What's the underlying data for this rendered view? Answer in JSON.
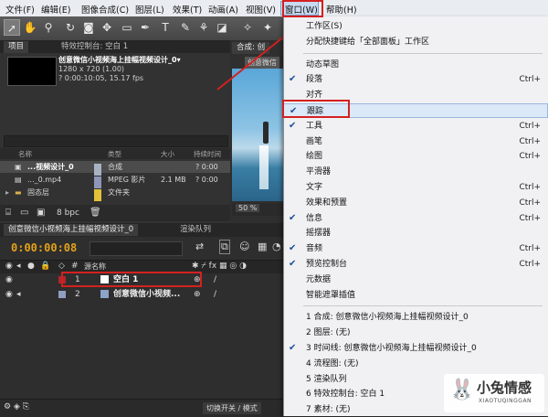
{
  "menubar": {
    "items": [
      "文件(F)",
      "编辑(E)",
      "图像合成(C)",
      "图层(L)",
      "效果(T)",
      "动画(A)",
      "视图(V)",
      "窗口(W)",
      "帮助(H)"
    ]
  },
  "project_panel": {
    "tabs": [
      "项目",
      "特效控制台: 空白 1"
    ],
    "comp_name": "创意微信小视频海上挂幅视频设计_0▾",
    "comp_res": "1280 x 720 (1.00)",
    "comp_duration": "? 0:00:10:05, 15.17 fps",
    "col_name": "名称",
    "col_type": "类型",
    "col_size": "大小",
    "col_duration": "持续时间",
    "rows": [
      {
        "name": "...视频设计_0",
        "type": "合成",
        "size": "",
        "dur": "? 0:00"
      },
      {
        "name": "..._0.mp4",
        "type": "MPEG 影片",
        "size": "2.1 MB",
        "dur": "? 0:00"
      },
      {
        "name": "固态层",
        "type": "文件夹",
        "size": "",
        "dur": ""
      }
    ],
    "bpc": "8 bpc"
  },
  "comp_viewer": {
    "tab": "合成: 创",
    "sub": "创意微信",
    "zoom": "50 %"
  },
  "timeline": {
    "tabs": [
      "创意微信小视频海上挂幅视频设计_0",
      "渲染队列"
    ],
    "timecode": "0:00:00:08",
    "col_source": "源名称",
    "layers": [
      {
        "num": "1",
        "name": "空白 1"
      },
      {
        "num": "2",
        "name": "创意微信小视频..."
      }
    ],
    "toggle_switch": "切换开关 / 模式"
  },
  "window_menu": {
    "items": [
      {
        "label": "工作区(S)",
        "shortcut": "",
        "checked": false
      },
      {
        "label": "分配快捷键给「全部面板」工作区",
        "shortcut": "",
        "checked": false
      },
      {
        "sep": true
      },
      {
        "label": "动态草图",
        "shortcut": "",
        "checked": false
      },
      {
        "label": "段落",
        "shortcut": "Ctrl+",
        "checked": true
      },
      {
        "label": "对齐",
        "shortcut": "",
        "checked": false
      },
      {
        "label": "跟踪",
        "shortcut": "",
        "checked": true,
        "highlight": true
      },
      {
        "label": "工具",
        "shortcut": "Ctrl+",
        "checked": true
      },
      {
        "label": "画笔",
        "shortcut": "Ctrl+",
        "checked": false
      },
      {
        "label": "绘图",
        "shortcut": "Ctrl+",
        "checked": false
      },
      {
        "label": "平滑器",
        "shortcut": "",
        "checked": false
      },
      {
        "label": "文字",
        "shortcut": "Ctrl+",
        "checked": false
      },
      {
        "label": "效果和预置",
        "shortcut": "Ctrl+",
        "checked": false
      },
      {
        "label": "信息",
        "shortcut": "Ctrl+",
        "checked": true
      },
      {
        "label": "摇摆器",
        "shortcut": "",
        "checked": false
      },
      {
        "label": "音频",
        "shortcut": "Ctrl+",
        "checked": true
      },
      {
        "label": "预览控制台",
        "shortcut": "Ctrl+",
        "checked": true
      },
      {
        "label": "元数据",
        "shortcut": "",
        "checked": false
      },
      {
        "label": "智能遮罩插值",
        "shortcut": "",
        "checked": false
      },
      {
        "sep": true
      },
      {
        "label": "1 合成: 创意微信小视频海上挂幅视频设计_0",
        "shortcut": "",
        "checked": false
      },
      {
        "label": "2 图层: (无)",
        "shortcut": "",
        "checked": false
      },
      {
        "label": "3 时间线: 创意微信小视频海上挂幅视频设计_0",
        "shortcut": "",
        "checked": true
      },
      {
        "label": "4 流程图: (无)",
        "shortcut": "",
        "checked": false
      },
      {
        "label": "5 渲染队列",
        "shortcut": "",
        "checked": false
      },
      {
        "label": "6 特效控制台: 空白 1",
        "shortcut": "",
        "checked": false
      },
      {
        "label": "7 素材: (无)",
        "shortcut": "",
        "checked": false
      }
    ]
  },
  "watermark": {
    "title": "小兔情感",
    "url": "XIAOTUQINGGAN"
  },
  "colors": {
    "accent_red": "#d42020",
    "timecode": "#e3a21a",
    "menu_highlight": "#dbe8f7"
  }
}
